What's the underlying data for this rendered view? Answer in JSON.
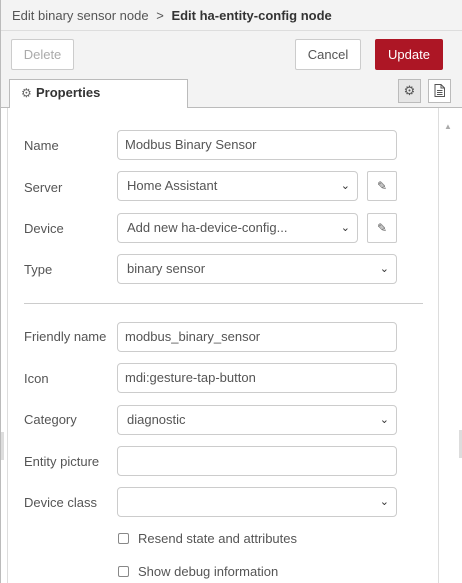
{
  "header": {
    "breadcrumb_parent": "Edit binary sensor node",
    "separator": ">",
    "current": "Edit ha-entity-config node"
  },
  "toolbar": {
    "delete_label": "Delete",
    "cancel_label": "Cancel",
    "update_label": "Update",
    "update_color": "#ad1625"
  },
  "tabs": {
    "properties_label": "Properties",
    "properties_icon": "gear-icon",
    "settings_icon": "gear-icon",
    "description_icon": "file-text-icon"
  },
  "form": {
    "name": {
      "label": "Name",
      "value": "Modbus Binary Sensor"
    },
    "server": {
      "label": "Server",
      "value": "Home Assistant",
      "edit_icon": "pencil-icon"
    },
    "device": {
      "label": "Device",
      "value": "Add new ha-device-config...",
      "edit_icon": "pencil-icon"
    },
    "type": {
      "label": "Type",
      "value": "binary sensor"
    },
    "friendly_name": {
      "label": "Friendly name",
      "value": "modbus_binary_sensor"
    },
    "icon": {
      "label": "Icon",
      "value": "mdi:gesture-tap-button"
    },
    "category": {
      "label": "Category",
      "value": "diagnostic"
    },
    "entity_picture": {
      "label": "Entity picture",
      "value": ""
    },
    "device_class": {
      "label": "Device class",
      "value": ""
    },
    "resend": {
      "label": "Resend state and attributes",
      "checked": false
    },
    "debug": {
      "label": "Show debug information",
      "checked": false
    }
  }
}
